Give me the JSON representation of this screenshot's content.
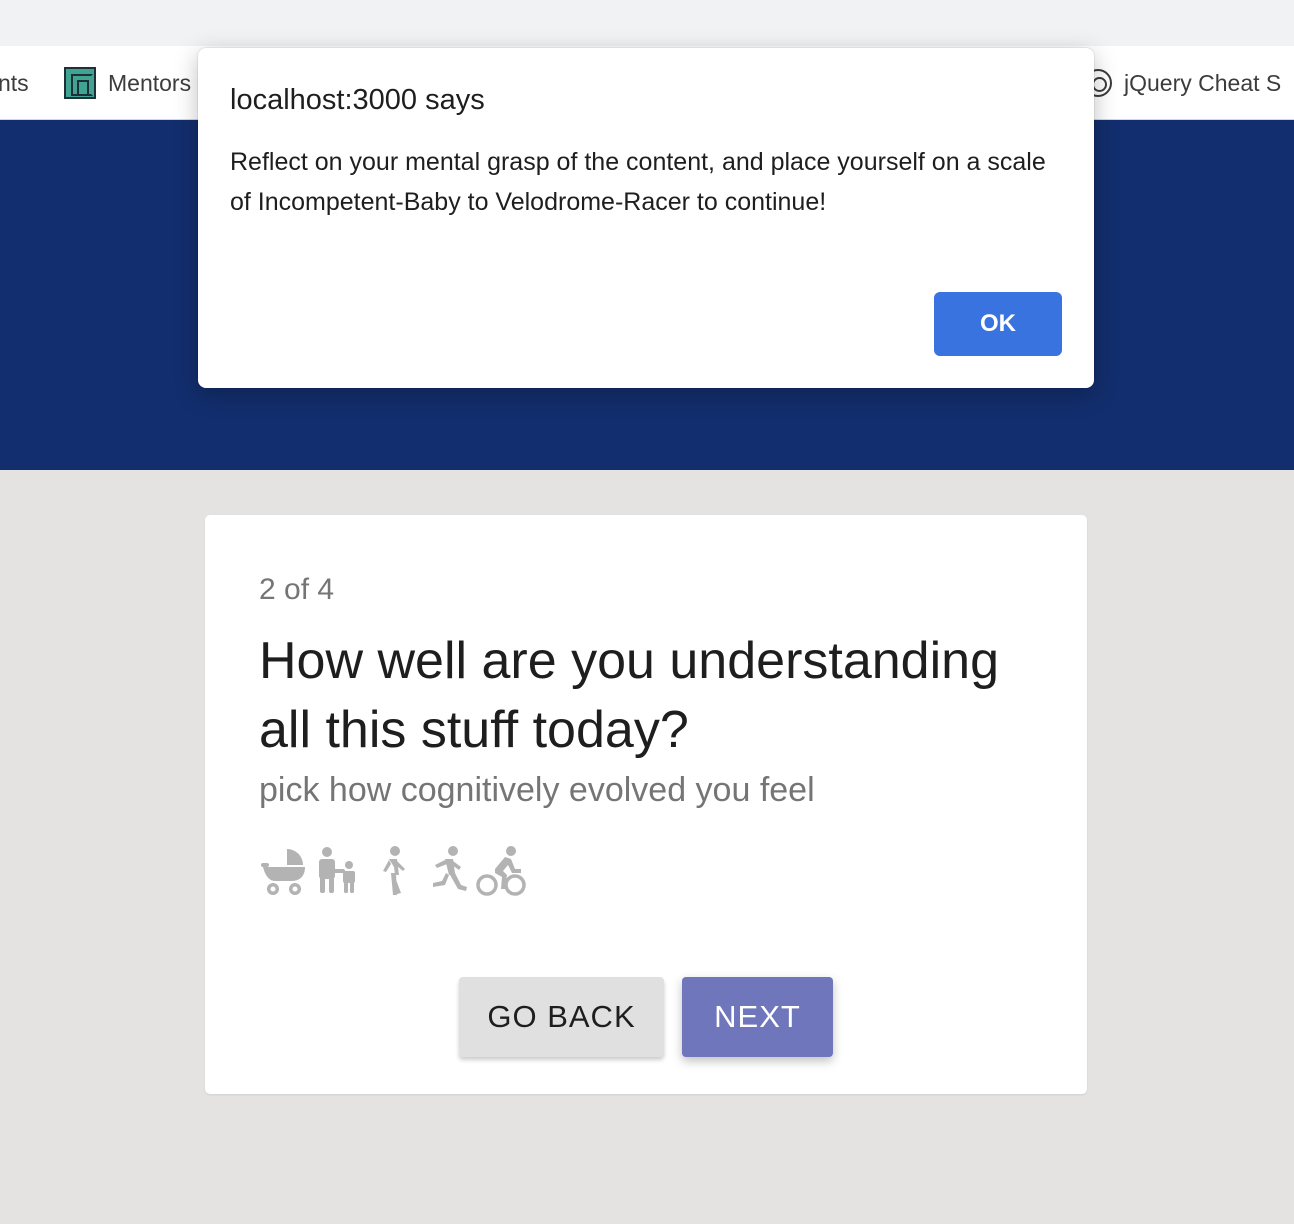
{
  "bookmarks": {
    "partial_left": "nts",
    "mentors": "Mentors",
    "jquery": "jQuery Cheat S"
  },
  "card": {
    "step": "2 of 4",
    "question": "How well are you understanding all this stuff today?",
    "subtitle": "pick how cognitively evolved you feel",
    "scale_icons": [
      "stroller-icon",
      "adult-with-child-icon",
      "walking-person-icon",
      "running-person-icon",
      "cyclist-icon"
    ],
    "back_label": "GO BACK",
    "next_label": "NEXT"
  },
  "dialog": {
    "title": "localhost:3000 says",
    "message": "Reflect on your mental grasp of the content, and place yourself on a scale of Incompetent-Baby to Velodrome-Racer to continue!",
    "ok_label": "OK"
  },
  "colors": {
    "header_band": "#132e6e",
    "page_bg": "#e4e3e2",
    "next_button": "#7076bb",
    "back_button": "#e0e0e0",
    "dialog_ok": "#3873e0",
    "icon_gray": "#b3b3b3"
  }
}
